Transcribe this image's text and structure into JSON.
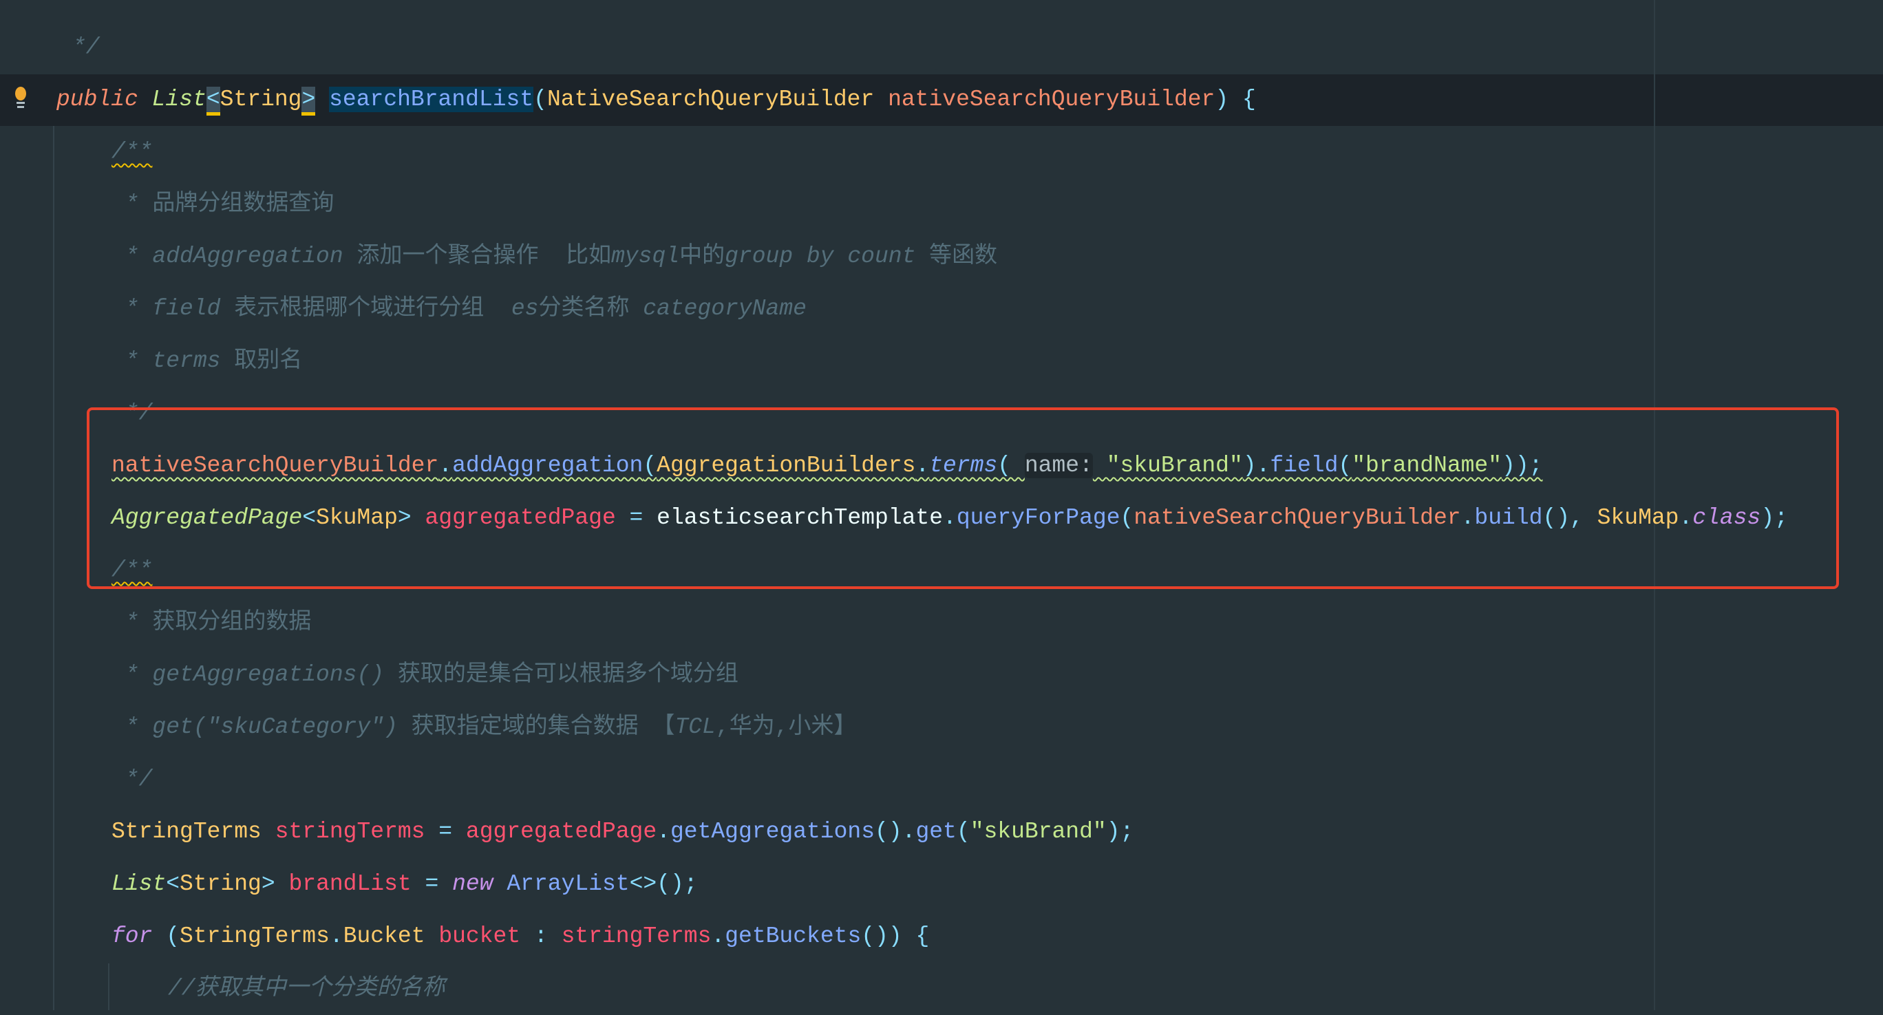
{
  "editor": {
    "colors": {
      "background": "#263238",
      "current_line": "#1c2329",
      "highlight_box": "#e8412b"
    },
    "gutter_icon": "lightbulb-icon",
    "lines": [
      {
        "indent": 0,
        "tokens": [
          [
            "*/",
            "ci"
          ]
        ]
      },
      {
        "indent": 1,
        "tokens": [
          [
            "public ",
            "kwp"
          ],
          [
            "List",
            "ti"
          ],
          [
            "<",
            "p brk"
          ],
          [
            "String",
            "ty"
          ],
          [
            ">",
            "p brk"
          ],
          [
            " ",
            "pl"
          ],
          [
            "searchBrandList",
            "fn sel"
          ],
          [
            "(",
            "p"
          ],
          [
            "NativeSearchQueryBuilder ",
            "ty"
          ],
          [
            "nativeSearchQueryBuilder",
            "pv"
          ],
          [
            ") {",
            "p"
          ]
        ]
      },
      {
        "indent": 2,
        "tokens": [
          [
            "/**",
            "ci wy"
          ]
        ]
      },
      {
        "indent": 2,
        "tokens": [
          [
            " * ",
            "ci"
          ],
          [
            "品牌分组数据查询",
            "c"
          ]
        ]
      },
      {
        "indent": 2,
        "tokens": [
          [
            " * addAggregation ",
            "ci"
          ],
          [
            "添加一个聚合操作  比如",
            "c"
          ],
          [
            "mysql",
            "ci"
          ],
          [
            "中的",
            "c"
          ],
          [
            "group by count ",
            "ci"
          ],
          [
            "等函数",
            "c"
          ]
        ]
      },
      {
        "indent": 2,
        "tokens": [
          [
            " * field ",
            "ci"
          ],
          [
            "表示根据哪个域进行分组  ",
            "c"
          ],
          [
            "es",
            "ci"
          ],
          [
            "分类名称 ",
            "c"
          ],
          [
            "categoryName",
            "ci"
          ]
        ]
      },
      {
        "indent": 2,
        "tokens": [
          [
            " * terms ",
            "ci"
          ],
          [
            "取别名",
            "c"
          ]
        ]
      },
      {
        "indent": 2,
        "tokens": [
          [
            " */",
            "ci"
          ]
        ]
      },
      {
        "indent": 2,
        "tokens": [
          [
            "nativeSearchQueryBuilder",
            "pv wg"
          ],
          [
            ".",
            "p wg"
          ],
          [
            "addAggregation",
            "fn wg"
          ],
          [
            "(",
            "p wg"
          ],
          [
            "AggregationBuilders",
            "ty wg"
          ],
          [
            ".",
            "p wg"
          ],
          [
            "terms",
            "fni wg"
          ],
          [
            "( ",
            "p wg"
          ],
          [
            "name:",
            "hint"
          ],
          [
            " \"skuBrand\"",
            "s wg"
          ],
          [
            ").",
            "p wg"
          ],
          [
            "field",
            "fn wg"
          ],
          [
            "(",
            "p wg"
          ],
          [
            "\"brandName\"",
            "s wg"
          ],
          [
            "));",
            "p wg"
          ]
        ]
      },
      {
        "indent": 2,
        "tokens": [
          [
            "AggregatedPage",
            "ti"
          ],
          [
            "<",
            "p"
          ],
          [
            "SkuMap",
            "ty"
          ],
          [
            "> ",
            "p"
          ],
          [
            "aggregatedPage",
            "lv"
          ],
          [
            " = ",
            "p"
          ],
          [
            "elasticsearchTemplate",
            "pl"
          ],
          [
            ".",
            "p"
          ],
          [
            "queryForPage",
            "fn"
          ],
          [
            "(",
            "p"
          ],
          [
            "nativeSearchQueryBuilder",
            "pv"
          ],
          [
            ".",
            "p"
          ],
          [
            "build",
            "fn"
          ],
          [
            "(), ",
            "p"
          ],
          [
            "SkuMap",
            "ty"
          ],
          [
            ".",
            "p"
          ],
          [
            "class",
            "k2"
          ],
          [
            ");",
            "p"
          ]
        ]
      },
      {
        "indent": 2,
        "tokens": [
          [
            "/**",
            "ci wy"
          ]
        ]
      },
      {
        "indent": 2,
        "tokens": [
          [
            " * ",
            "ci"
          ],
          [
            "获取分组的数据",
            "c"
          ]
        ]
      },
      {
        "indent": 2,
        "tokens": [
          [
            " * getAggregations() ",
            "ci"
          ],
          [
            "获取的是集合可以根据多个域分组",
            "c"
          ]
        ]
      },
      {
        "indent": 2,
        "tokens": [
          [
            " * get(\"skuCategory\") ",
            "ci"
          ],
          [
            "获取指定域的集合数据 【",
            "c"
          ],
          [
            "TCL",
            "ci"
          ],
          [
            ",华为,小米】",
            "c"
          ]
        ]
      },
      {
        "indent": 2,
        "tokens": [
          [
            " */",
            "ci"
          ]
        ]
      },
      {
        "indent": 2,
        "tokens": [
          [
            "StringTerms ",
            "ty"
          ],
          [
            "stringTerms",
            "lv"
          ],
          [
            " = ",
            "p"
          ],
          [
            "aggregatedPage",
            "lv"
          ],
          [
            ".",
            "p"
          ],
          [
            "getAggregations",
            "fn"
          ],
          [
            "().",
            "p"
          ],
          [
            "get",
            "fn"
          ],
          [
            "(",
            "p"
          ],
          [
            "\"skuBrand\"",
            "s"
          ],
          [
            ");",
            "p"
          ]
        ]
      },
      {
        "indent": 2,
        "tokens": [
          [
            "List",
            "ti"
          ],
          [
            "<",
            "p"
          ],
          [
            "String",
            "ty"
          ],
          [
            "> ",
            "p"
          ],
          [
            "brandList",
            "lv"
          ],
          [
            " = ",
            "p"
          ],
          [
            "new ",
            "k2"
          ],
          [
            "ArrayList",
            "fn"
          ],
          [
            "<>();",
            "p"
          ]
        ]
      },
      {
        "indent": 2,
        "tokens": [
          [
            "for ",
            "k2"
          ],
          [
            "(",
            "p"
          ],
          [
            "StringTerms",
            "ty"
          ],
          [
            ".",
            "p"
          ],
          [
            "Bucket ",
            "ty"
          ],
          [
            "bucket",
            "lv"
          ],
          [
            " : ",
            "p"
          ],
          [
            "stringTerms",
            "lv"
          ],
          [
            ".",
            "p"
          ],
          [
            "getBuckets",
            "fn"
          ],
          [
            "()) {",
            "p"
          ]
        ]
      },
      {
        "indent": 3,
        "tokens": [
          [
            "//获取其中一个分类的名称",
            "ci"
          ]
        ]
      }
    ]
  }
}
